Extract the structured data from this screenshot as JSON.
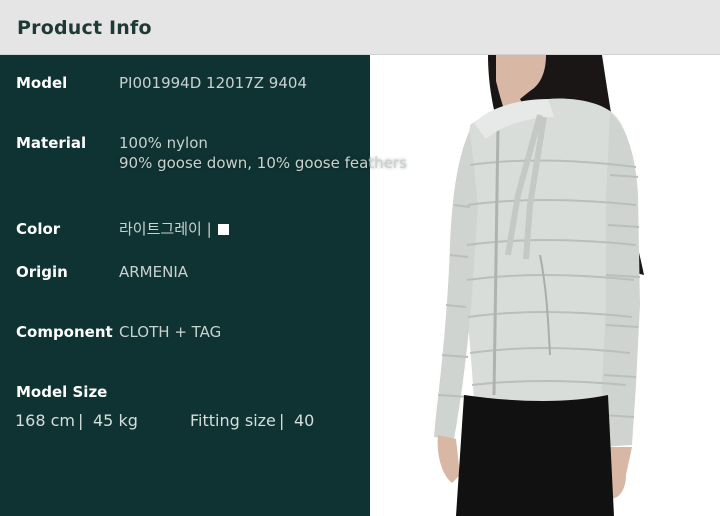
{
  "header": {
    "title": "Product Info"
  },
  "info": {
    "model": {
      "label": "Model",
      "value": "PI001994D 12017Z 9404"
    },
    "material": {
      "label": "Material",
      "line1": "100% nylon",
      "line2": "90% goose down, 10% goose feathers"
    },
    "color": {
      "label": "Color",
      "value": "라이트그레이 |",
      "swatch_color": "#ffffff"
    },
    "origin": {
      "label": "Origin",
      "value": "ARMENIA"
    },
    "component": {
      "label": "Component",
      "value": "CLOTH + TAG"
    }
  },
  "model_size": {
    "label": "Model Size",
    "height": "168 cm",
    "sep1": "|",
    "weight": "45 kg",
    "fitting_label": "Fitting size",
    "sep2": "|",
    "fitting_value": "40"
  },
  "colors": {
    "panel": "#0f3332",
    "header_bg": "#e5e5e5",
    "header_text": "#1f3a36",
    "jacket": "#d9ddda",
    "hair": "#1a1616",
    "pants": "#111111"
  }
}
